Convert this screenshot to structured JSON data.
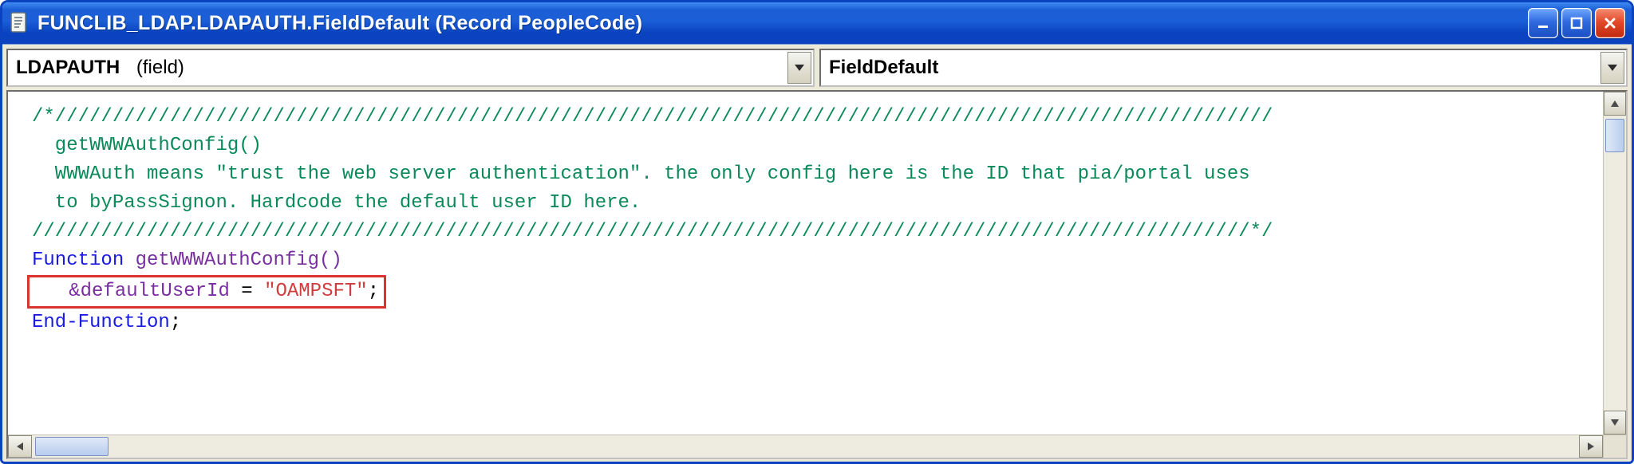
{
  "window": {
    "title": "FUNCLIB_LDAP.LDAPAUTH.FieldDefault (Record PeopleCode)"
  },
  "dropdowns": {
    "field_main": "LDAPAUTH",
    "field_sub": "(field)",
    "event": "FieldDefault"
  },
  "code": {
    "comment_open": "/*//////////////////////////////////////////////////////////////////////////////////////////////////////////",
    "comment_l1": "  getWWWAuthConfig()",
    "comment_l2": "  WWWAuth means \"trust the web server authentication\". the only config here is the ID that pia/portal uses",
    "comment_l3": "  to byPassSignon. Hardcode the default user ID here.",
    "comment_close": "//////////////////////////////////////////////////////////////////////////////////////////////////////////*/",
    "kw_function": "Function",
    "fn_name": " getWWWAuthConfig()",
    "assign_ident": "   &defaultUserId",
    "assign_eq": " = ",
    "assign_str": "\"OAMPSFT\"",
    "assign_semi": ";",
    "kw_endfn": "End-Function",
    "end_semi": ";"
  }
}
